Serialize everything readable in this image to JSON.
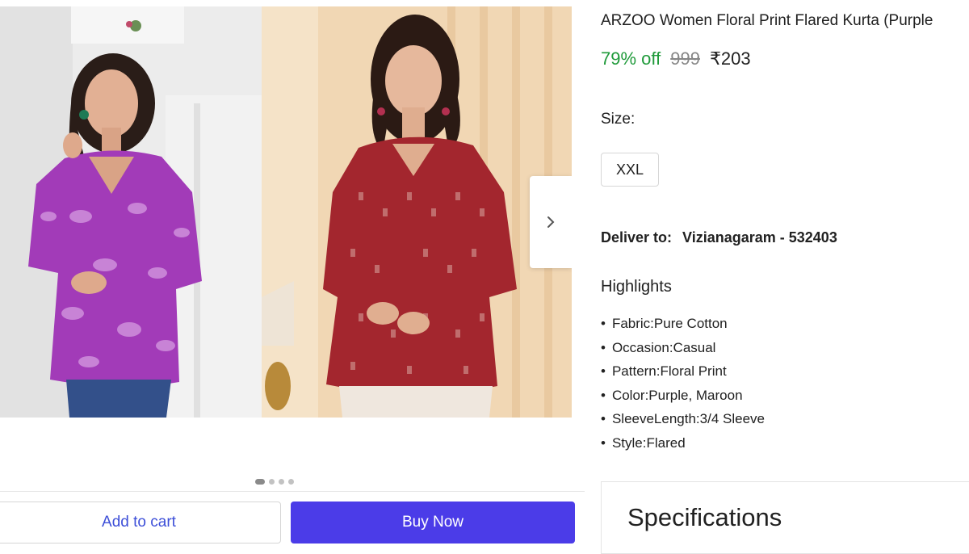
{
  "product": {
    "title": "ARZOO Women Floral Print Flared Kurta (Purple",
    "discount": "79% off",
    "mrp": "999",
    "price": "₹203"
  },
  "size": {
    "label": "Size:",
    "selected": "XXL"
  },
  "delivery": {
    "label": "Deliver to:",
    "location": "Vizianagaram - 532403"
  },
  "highlights": {
    "title": "Highlights",
    "items": [
      "Fabric:Pure Cotton",
      "Occasion:Casual",
      "Pattern:Floral Print",
      "Color:Purple, Maroon",
      "SleeveLength:3/4 Sleeve",
      "Style:Flared"
    ]
  },
  "specifications": {
    "title": "Specifications"
  },
  "actions": {
    "add_to_cart": "Add to cart",
    "buy_now": "Buy Now"
  },
  "carousel": {
    "slide_count": 4,
    "active_slide": 1,
    "icons": {
      "next": "chevron-right-icon"
    }
  },
  "colors": {
    "accent": "#4b3ce8",
    "discount": "#1f9a3a",
    "purple_kurta": "#a23bb8",
    "maroon_kurta": "#a3262e"
  }
}
